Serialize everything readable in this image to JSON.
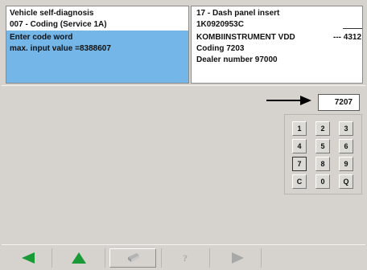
{
  "header_left": {
    "title": "Vehicle self-diagnosis",
    "function": "007 - Coding (Service 1A)",
    "prompt": "Enter code word",
    "hint": "max. input value =8388607"
  },
  "header_right": {
    "module": "17 - Dash panel insert",
    "part_number": "1K0920953C",
    "component": "KOMBIINSTRUMENT VDD",
    "component_extra": "--- 4312",
    "coding": "Coding 7203",
    "dealer": "Dealer number 97000"
  },
  "input": {
    "value": "7207"
  },
  "keypad": {
    "keys": [
      "1",
      "2",
      "3",
      "4",
      "5",
      "6",
      "7",
      "8",
      "9",
      "C",
      "0",
      "Q"
    ],
    "selected_key": "7"
  },
  "icons": {
    "arrow": "arrow-right-icon",
    "back": "arrow-left-icon",
    "up": "arrow-up-icon",
    "print": "print-icon",
    "help": "help-icon",
    "forward": "play-icon"
  },
  "colors": {
    "highlight": "#73b6e7",
    "background": "#d6d3ce",
    "nav_active": "#1a9a36",
    "nav_inactive": "#a8a8a8"
  }
}
